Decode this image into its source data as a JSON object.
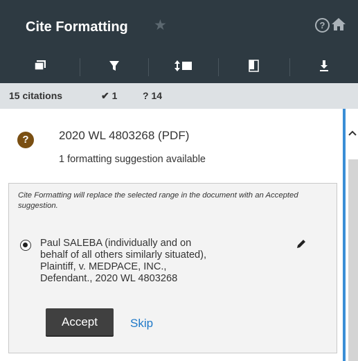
{
  "header": {
    "title": "Cite Formatting",
    "star_icon": "star-icon",
    "help_icon": "help-circle-icon",
    "help_glyph": "?",
    "home_icon": "home-icon"
  },
  "toolbar": {
    "tools": [
      {
        "icon": "copy-stack-icon"
      },
      {
        "icon": "filter-icon"
      },
      {
        "icon": "sort-icon"
      },
      {
        "icon": "document-pane-icon"
      },
      {
        "icon": "download-icon"
      }
    ]
  },
  "status": {
    "citations": "15 citations",
    "accepted": "✔ 1",
    "pending": "? 14"
  },
  "citation": {
    "badge": "?",
    "title": "2020 WL 4803268 (PDF)",
    "subtitle": "1 formatting suggestion available",
    "note": "Cite Formatting will replace the selected range in the document with an Accepted suggestion.",
    "suggestion_lines": [
      "Paul SALEBA (individually and on",
      "behalf of all others similarly situated),",
      "Plaintiff, v. MEDPACE, INC.,",
      "Defendant., 2020 WL 4803268"
    ],
    "accept_label": "Accept",
    "skip_label": "Skip"
  },
  "colors": {
    "header_bg": "#2e3a42",
    "statusbar_bg": "#dde1e4",
    "badge_bg": "#7a4f12",
    "accent_blue": "#3a8ed6",
    "link": "#1e78c8",
    "accept_bg": "#404040"
  }
}
